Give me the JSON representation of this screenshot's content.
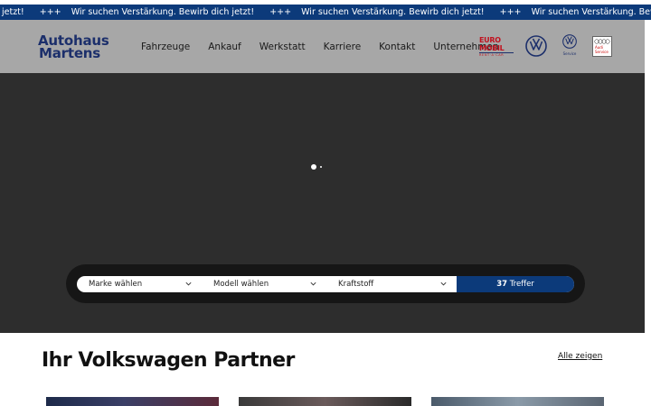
{
  "ticker": {
    "lead": "jetzt!",
    "separator": "+++",
    "message": "Wir suchen Verstärkung. Bewirb dich jetzt!"
  },
  "header": {
    "logo_line1": "Autohaus",
    "logo_line2": "Martens",
    "nav": [
      "Fahrzeuge",
      "Ankauf",
      "Werkstatt",
      "Karriere",
      "Kontakt",
      "Unternehmen"
    ],
    "brands": {
      "euromobil_line1": "EURO",
      "euromobil_line2": "MOBIL",
      "euromobil_sub": "RENT·A·CAR",
      "vw_service_label": "Service",
      "audi_line1": "Audi",
      "audi_line2": "Service"
    }
  },
  "hero": {
    "slides_total": 2,
    "active_slide": 1
  },
  "search": {
    "brand_select": "Marke wählen",
    "model_select": "Modell wählen",
    "fuel_select": "Kraftstoff",
    "result_count": "37",
    "result_label": "Treffer"
  },
  "section": {
    "title": "Ihr Volkswagen Partner",
    "see_all": "Alle zeigen"
  },
  "colors": {
    "brand_blue": "#0c3a7a",
    "logo_navy": "#1c2f6b",
    "header_gray": "#a7a7a7",
    "hero_dark": "#2d2d2d",
    "euromobil_red": "#c1121f"
  }
}
